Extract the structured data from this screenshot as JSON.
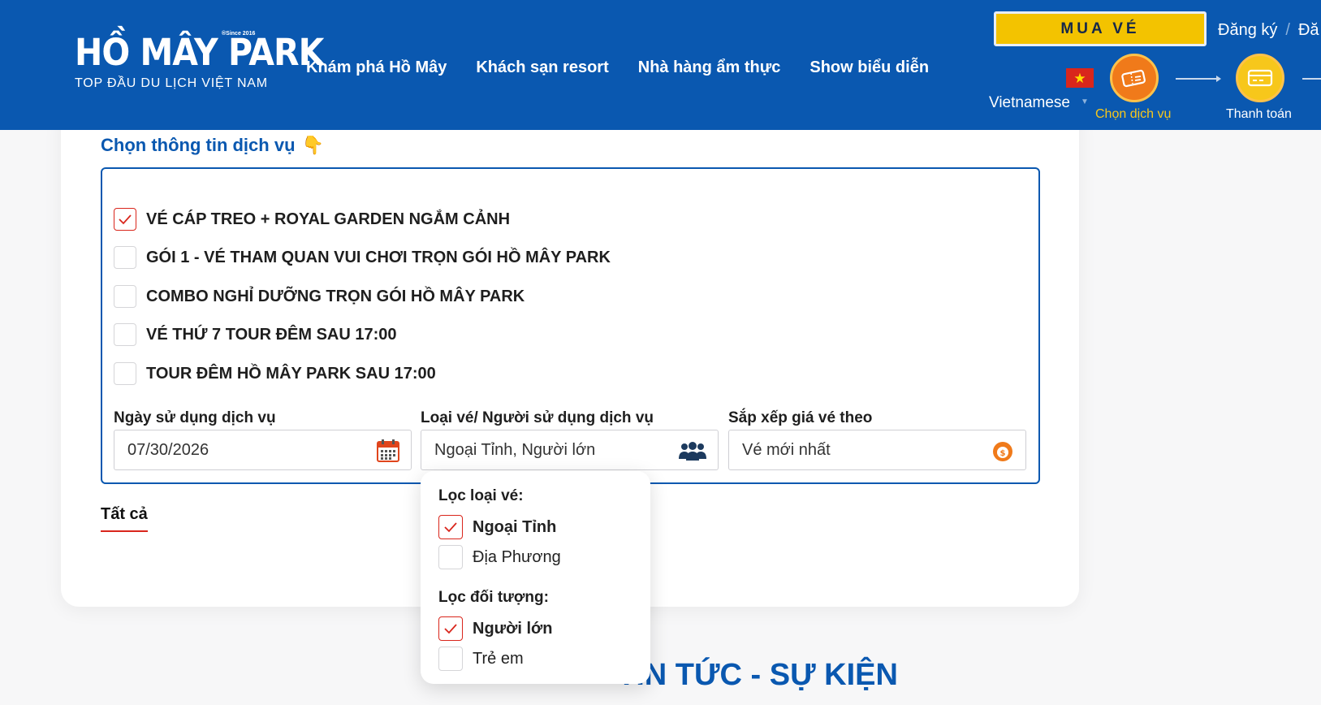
{
  "header": {
    "logo_text": "HỒ MÂY PARK",
    "logo_since": "®Since 2016",
    "logo_tagline": "TOP ĐẦU DU LỊCH VIỆT NAM",
    "nav": [
      "Khám phá Hồ Mây",
      "Khách sạn resort",
      "Nhà hàng ẩm thực",
      "Show biểu diễn"
    ],
    "buy_button": "MUA VÉ",
    "register": "Đăng ký",
    "separator": "/",
    "login_partial": "Đă",
    "language": "Vietnamese",
    "flag_star": "★",
    "steps": [
      {
        "label": "Chọn dịch vụ",
        "icon": "ticket-icon",
        "active": true
      },
      {
        "label": "Thanh toán",
        "icon": "credit-card-icon",
        "active": false
      }
    ]
  },
  "service_section": {
    "title": "Chọn thông tin dịch vụ",
    "title_emoji": "👇",
    "options": [
      {
        "label": "VÉ CÁP TREO + ROYAL GARDEN NGẮM CẢNH",
        "checked": true
      },
      {
        "label": "GÓI 1 - VÉ THAM QUAN VUI CHƠI TRỌN GÓI HỒ MÂY PARK",
        "checked": false
      },
      {
        "label": "COMBO NGHỈ DƯỠNG TRỌN GÓI HỒ MÂY PARK",
        "checked": false
      },
      {
        "label": "VÉ THỨ 7 TOUR ĐÊM SAU 17:00",
        "checked": false
      },
      {
        "label": "TOUR ĐÊM HỒ MÂY PARK SAU 17:00",
        "checked": false
      }
    ],
    "fields": {
      "date": {
        "label": "Ngày sử dụng dịch vụ",
        "value": "07/30/2026",
        "icon": "calendar-icon"
      },
      "ticket_type": {
        "label": "Loại vé/ Người sử dụng dịch vụ",
        "value": "Ngoại Tỉnh, Người lớn",
        "icon": "users-icon"
      },
      "sort": {
        "label": "Sắp xếp giá vé theo",
        "value": "Vé mới nhất",
        "icon": "money-bag-icon"
      }
    },
    "tab_all": "Tất cả"
  },
  "dropdown": {
    "ticket_filter_title": "Lọc loại vé:",
    "ticket_filters": [
      {
        "label": "Ngoại Tỉnh",
        "checked": true
      },
      {
        "label": "Địa Phương",
        "checked": false
      }
    ],
    "audience_filter_title": "Lọc đối tượng:",
    "audience_filters": [
      {
        "label": "Người lớn",
        "checked": true
      },
      {
        "label": "Trẻ em",
        "checked": false
      }
    ]
  },
  "news_title": "TIN TỨC - SỰ KIỆN",
  "colors": {
    "primary_blue": "#0a58b0",
    "buy_yellow": "#f3c300",
    "step_orange": "#f07a1a",
    "check_red": "#d9261c"
  }
}
